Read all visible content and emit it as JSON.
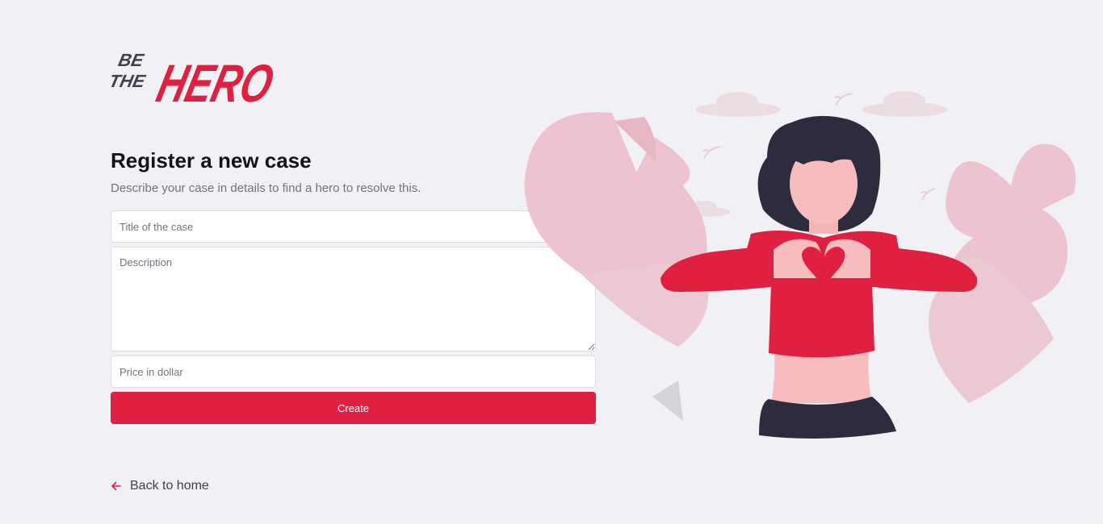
{
  "logo": {
    "line1": "BE",
    "line2": "THE",
    "word": "HERO",
    "icon": "be-the-hero-logo"
  },
  "header": {
    "title": "Register a new case",
    "subtitle": "Describe your case in details to find a hero to resolve this."
  },
  "form": {
    "title_placeholder": "Title of the case",
    "title_value": "",
    "description_placeholder": "Description",
    "description_value": "",
    "price_placeholder": "Price in dollar",
    "price_value": "",
    "submit_label": "Create"
  },
  "footer": {
    "back_label": "Back to home",
    "back_icon": "arrow-left-icon"
  },
  "illustration": {
    "name": "woman-heart-hands-illustration"
  },
  "colors": {
    "brand": "#e02041",
    "background": "#f0f0f5",
    "text_dark": "#13131a",
    "text_muted": "#737380"
  }
}
